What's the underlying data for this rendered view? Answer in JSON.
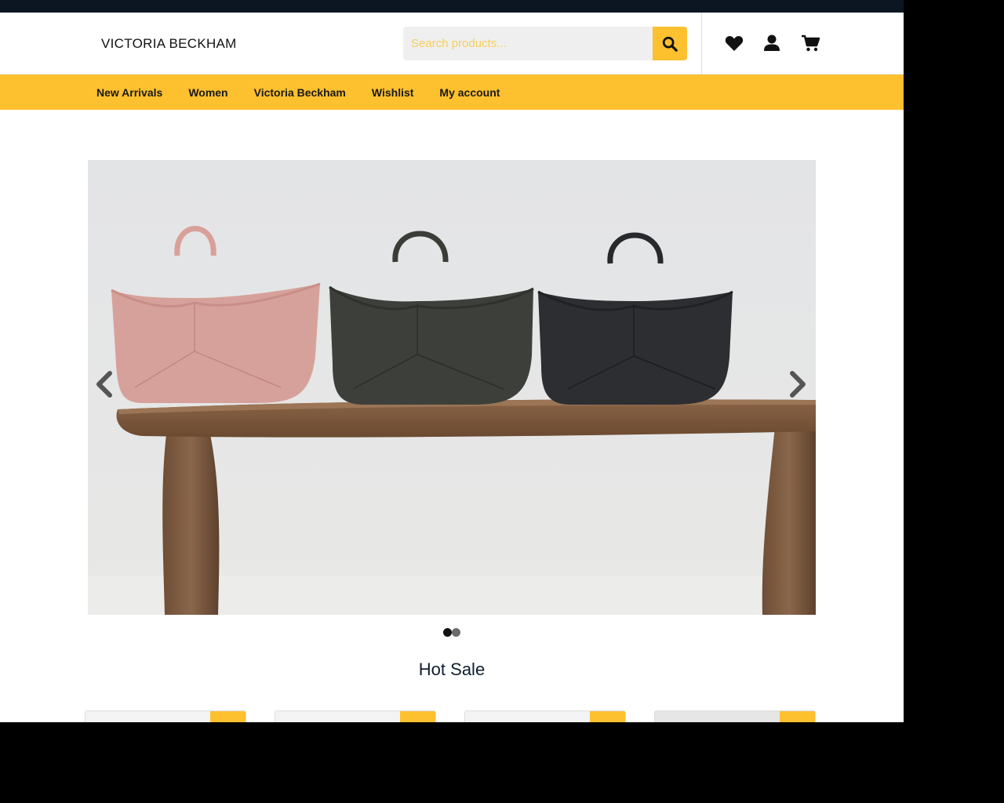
{
  "brand": {
    "logo_text": "VICTORIA BECKHAM"
  },
  "search": {
    "placeholder": "Search products..."
  },
  "header_icons": [
    "heart-icon",
    "user-icon",
    "cart-icon"
  ],
  "nav": {
    "items": [
      {
        "label": "New Arrivals"
      },
      {
        "label": "Women"
      },
      {
        "label": "Victoria Beckham"
      },
      {
        "label": "Wishlist"
      },
      {
        "label": "My account"
      }
    ]
  },
  "slider": {
    "slides_count": 2,
    "active_index": 0,
    "image_alt": "Three tote bags on a wooden bench"
  },
  "hot_sale": {
    "title": "Hot Sale"
  },
  "colors": {
    "accent": "#fdc02f",
    "topbar": "#0b1622",
    "title": "#0f1e2e"
  }
}
